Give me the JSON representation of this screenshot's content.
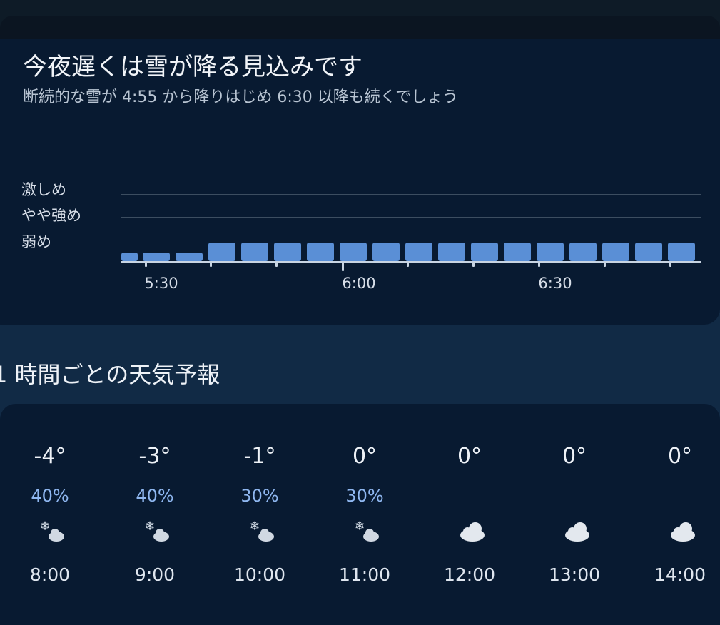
{
  "precip_card": {
    "headline": "今夜遅くは雪が降る見込みです",
    "subline": "断続的な雪が 4:55 から降りはじめ 6:30 以降も続くでしょう",
    "intensity_labels": [
      "激しめ",
      "やや強め",
      "弱め"
    ],
    "time_labels": [
      "5:30",
      "6:00",
      "6:30"
    ]
  },
  "chart_data": {
    "type": "bar",
    "title": "",
    "xlabel": "",
    "ylabel": "",
    "y_categories": [
      "弱め",
      "やや強め",
      "激しめ"
    ],
    "x_ticks": [
      "5:30",
      "6:00",
      "6:30"
    ],
    "interval_minutes": 5,
    "values": [
      0.4,
      0.4,
      0.4,
      0.85,
      0.85,
      0.85,
      0.85,
      0.85,
      0.85,
      0.85,
      0.85,
      0.85,
      0.85,
      0.85,
      0.85,
      0.85,
      0.85,
      0.85
    ],
    "color": "#5a8fd6"
  },
  "hourly": {
    "title": "1 時間ごとの天気予報",
    "items": [
      {
        "temp": "-4°",
        "pop": "40%",
        "icon": "snow-cloud-icon",
        "time": "8:00"
      },
      {
        "temp": "-3°",
        "pop": "40%",
        "icon": "snow-cloud-icon",
        "time": "9:00"
      },
      {
        "temp": "-1°",
        "pop": "30%",
        "icon": "snow-cloud-icon",
        "time": "10:00"
      },
      {
        "temp": "0°",
        "pop": "30%",
        "icon": "snow-cloud-icon",
        "time": "11:00"
      },
      {
        "temp": "0°",
        "pop": "",
        "icon": "cloud-icon",
        "time": "12:00"
      },
      {
        "temp": "0°",
        "pop": "",
        "icon": "cloud-icon",
        "time": "13:00"
      },
      {
        "temp": "0°",
        "pop": "",
        "icon": "cloud-icon",
        "time": "14:00"
      }
    ]
  }
}
